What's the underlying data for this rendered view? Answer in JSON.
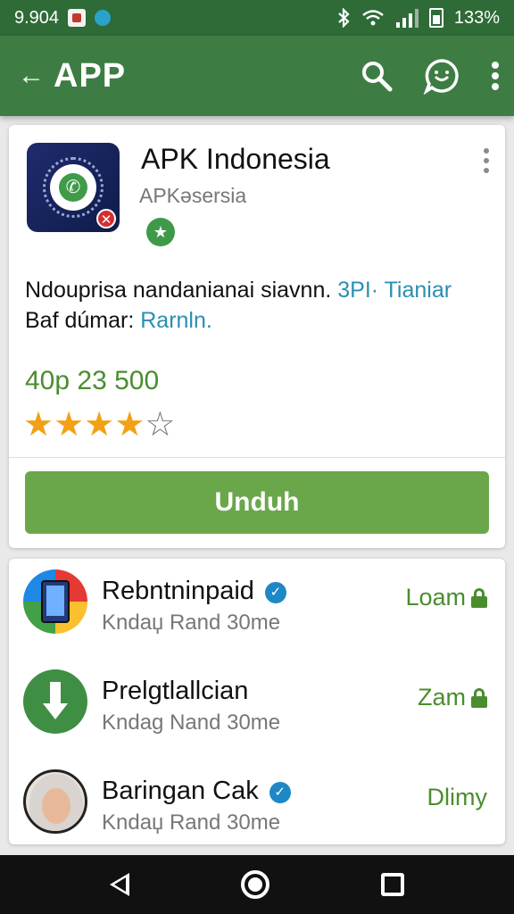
{
  "status_bar": {
    "time": "9.904",
    "battery_text": "133%",
    "icons": [
      "notification-icon",
      "app-notification-icon",
      "bluetooth-icon",
      "wifi-icon",
      "signal-icon",
      "battery-icon"
    ]
  },
  "app_bar": {
    "back_glyph": "←",
    "title": "APP",
    "icons": [
      "search-icon",
      "chat-icon",
      "more-vert-icon"
    ],
    "color": "#3d7d44"
  },
  "featured_app": {
    "name": "APK Indonesia",
    "developer": "APKəsersia",
    "badge_glyph": "★",
    "description_text": "Ndouprisa nandanianai siavnn. ",
    "description_link1": "3PI· Tianiar",
    "description_line2": "Baf dúmar: ",
    "description_link2": "Rarnln.",
    "price": "40p 23 500",
    "rating": 4,
    "rating_max": 5,
    "install_label": "Unduh",
    "install_color": "#6aa74b"
  },
  "app_list": [
    {
      "name": "Rebntninpaid",
      "verified": true,
      "subtitle": "Kndaџ Rand 30me",
      "action": "Loam",
      "icon": "phone-app-icon"
    },
    {
      "name": "Prelgtlallcian",
      "verified": false,
      "subtitle": "Kndag Nand 30me",
      "action": "Zam",
      "icon": "download-icon"
    },
    {
      "name": "Baringan Cak",
      "verified": true,
      "subtitle": "Kndaџ Rand 30me",
      "action": "Dlimy",
      "icon": "avatar-icon"
    }
  ],
  "nav_bar": {
    "icons": [
      "nav-back-icon",
      "nav-home-icon",
      "nav-recents-icon"
    ]
  }
}
